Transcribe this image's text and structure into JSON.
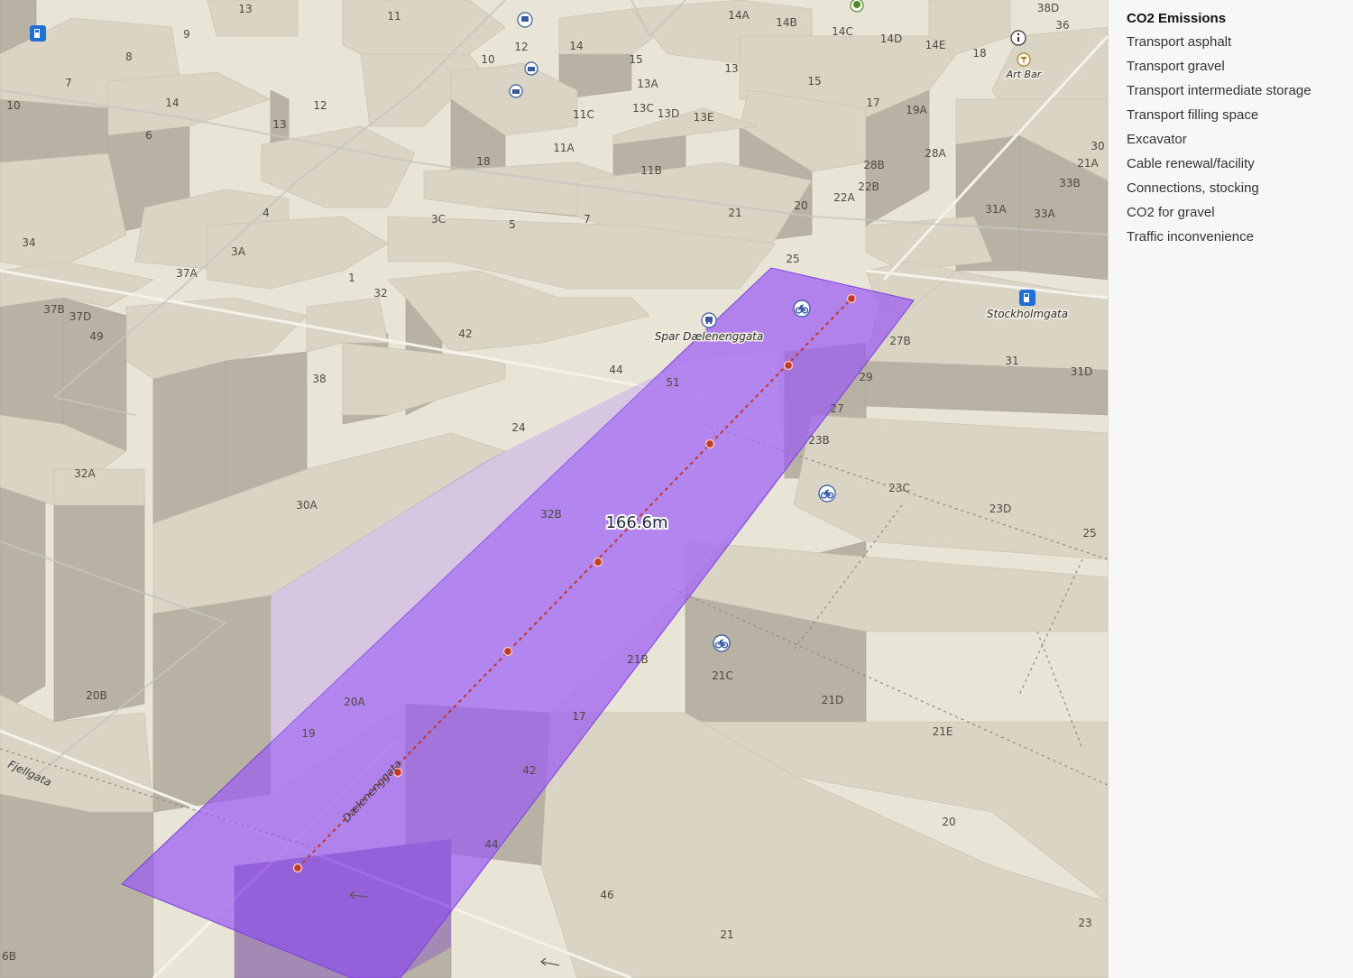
{
  "legend": {
    "title": "CO2 Emissions",
    "items": [
      "Transport asphalt",
      "Transport gravel",
      "Transport intermediate storage",
      "Transport filling space",
      "Excavator",
      "Cable renewal/facility",
      "Connections, stocking",
      "CO2 for gravel",
      "Traffic inconvenience"
    ]
  },
  "map": {
    "measurement": "166.6m",
    "poi": {
      "shop": "Spar Dælenenggata",
      "station": "Stockholmgata",
      "bar": "Art Bar"
    },
    "streets": {
      "main": "Dælenenggata",
      "fjell": "Fjellgata"
    },
    "house_numbers": [
      "13",
      "11",
      "9",
      "8",
      "7",
      "10",
      "14",
      "12",
      "13",
      "6",
      "4",
      "3A",
      "1",
      "32",
      "34",
      "37A",
      "37B",
      "37D",
      "49",
      "38",
      "42",
      "44",
      "51",
      "24",
      "32B",
      "32A",
      "30A",
      "20B",
      "20A",
      "19",
      "17",
      "42",
      "44",
      "46",
      "21",
      "21B",
      "21C",
      "21D",
      "21E",
      "20",
      "23",
      "23B",
      "23C",
      "23D",
      "25",
      "27",
      "27B",
      "29",
      "31",
      "31D",
      "31A",
      "33A",
      "33B",
      "21A",
      "30",
      "28A",
      "28B",
      "22B",
      "22A",
      "20",
      "21",
      "7",
      "5",
      "3C",
      "18",
      "11A",
      "11B",
      "11C",
      "13C",
      "13D",
      "13E",
      "13A",
      "15",
      "14",
      "12",
      "10",
      "14A",
      "14B",
      "14C",
      "14D",
      "14E",
      "18",
      "19A",
      "17",
      "15",
      "13",
      "36",
      "38D",
      "6B",
      "25"
    ],
    "colors": {
      "selection": "#9b5cf2",
      "route": "#c0392b",
      "building_top": "#d9d4c3",
      "building_side": "#b7b2a3",
      "ground": "#e9e5d6"
    },
    "icons": [
      "bicycle-icon",
      "bicycle-icon",
      "bicycle-icon",
      "bus-icon",
      "fuel-icon",
      "fuel-icon",
      "info-icon",
      "bar-icon",
      "tree-icon",
      "bus-icon",
      "camera-icon",
      "camera-icon"
    ]
  }
}
